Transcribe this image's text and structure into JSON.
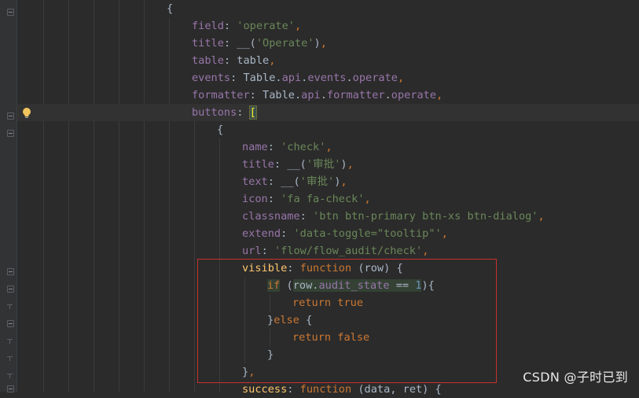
{
  "editor": {
    "lines": [
      {
        "parts": [
          {
            "t": "{",
            "c": "plain"
          }
        ]
      },
      {
        "parts": [
          {
            "t": "field",
            "c": "p"
          },
          {
            "t": ": ",
            "c": "plain"
          },
          {
            "t": "'operate'",
            "c": "s"
          },
          {
            "t": ",",
            "c": "k"
          }
        ]
      },
      {
        "parts": [
          {
            "t": "title",
            "c": "p"
          },
          {
            "t": ": __(",
            "c": "plain"
          },
          {
            "t": "'Operate'",
            "c": "s"
          },
          {
            "t": ")",
            "c": "plain"
          },
          {
            "t": ",",
            "c": "k"
          }
        ]
      },
      {
        "parts": [
          {
            "t": "table",
            "c": "p"
          },
          {
            "t": ": table",
            "c": "plain"
          },
          {
            "t": ",",
            "c": "k"
          }
        ]
      },
      {
        "parts": [
          {
            "t": "events",
            "c": "p"
          },
          {
            "t": ": Table.",
            "c": "plain"
          },
          {
            "t": "api",
            "c": "p"
          },
          {
            "t": ".",
            "c": "plain"
          },
          {
            "t": "events",
            "c": "p"
          },
          {
            "t": ".",
            "c": "plain"
          },
          {
            "t": "operate",
            "c": "p"
          },
          {
            "t": ",",
            "c": "k"
          }
        ]
      },
      {
        "parts": [
          {
            "t": "formatter",
            "c": "p"
          },
          {
            "t": ": Table.",
            "c": "plain"
          },
          {
            "t": "api",
            "c": "p"
          },
          {
            "t": ".",
            "c": "plain"
          },
          {
            "t": "formatter",
            "c": "p"
          },
          {
            "t": ".",
            "c": "plain"
          },
          {
            "t": "operate",
            "c": "p"
          },
          {
            "t": ",",
            "c": "k"
          }
        ]
      },
      {
        "parts": [
          {
            "t": "buttons",
            "c": "p"
          },
          {
            "t": ": ",
            "c": "plain"
          },
          {
            "t": "[",
            "c": "bracket-hl"
          }
        ]
      },
      {
        "parts": [
          {
            "t": "{",
            "c": "plain"
          }
        ]
      },
      {
        "parts": [
          {
            "t": "name",
            "c": "p"
          },
          {
            "t": ": ",
            "c": "plain"
          },
          {
            "t": "'check'",
            "c": "s"
          },
          {
            "t": ",",
            "c": "k"
          }
        ]
      },
      {
        "parts": [
          {
            "t": "title",
            "c": "p"
          },
          {
            "t": ": __(",
            "c": "plain"
          },
          {
            "t": "'审批'",
            "c": "s"
          },
          {
            "t": ")",
            "c": "plain"
          },
          {
            "t": ",",
            "c": "k"
          }
        ]
      },
      {
        "parts": [
          {
            "t": "text",
            "c": "p"
          },
          {
            "t": ": __(",
            "c": "plain"
          },
          {
            "t": "'审批'",
            "c": "s"
          },
          {
            "t": ")",
            "c": "plain"
          },
          {
            "t": ",",
            "c": "k"
          }
        ]
      },
      {
        "parts": [
          {
            "t": "icon",
            "c": "p"
          },
          {
            "t": ": ",
            "c": "plain"
          },
          {
            "t": "'fa fa-check'",
            "c": "s"
          },
          {
            "t": ",",
            "c": "k"
          }
        ]
      },
      {
        "parts": [
          {
            "t": "classname",
            "c": "p"
          },
          {
            "t": ": ",
            "c": "plain"
          },
          {
            "t": "'btn btn-primary btn-xs btn-dialog'",
            "c": "s"
          },
          {
            "t": ",",
            "c": "k"
          }
        ]
      },
      {
        "parts": [
          {
            "t": "extend",
            "c": "p"
          },
          {
            "t": ": ",
            "c": "plain"
          },
          {
            "t": "'data-toggle=\"tooltip\"'",
            "c": "s"
          },
          {
            "t": ",",
            "c": "k"
          }
        ]
      },
      {
        "parts": [
          {
            "t": "url",
            "c": "p"
          },
          {
            "t": ": ",
            "c": "plain"
          },
          {
            "t": "'flow/flow_audit/check'",
            "c": "s"
          },
          {
            "t": ",",
            "c": "k"
          }
        ]
      },
      {
        "parts": [
          {
            "t": "visible",
            "c": "fn"
          },
          {
            "t": ": ",
            "c": "plain"
          },
          {
            "t": "function ",
            "c": "k"
          },
          {
            "t": "(row) {",
            "c": "plain"
          }
        ]
      },
      {
        "parts": [
          {
            "t": "if",
            "c": "k hl-k"
          },
          {
            "t": " (",
            "c": "plain"
          },
          {
            "t": "row.",
            "c": "hl"
          },
          {
            "t": "audit_state",
            "c": "p hl-k"
          },
          {
            "t": " == ",
            "c": "hl"
          },
          {
            "t": "1",
            "c": "n hl-k"
          },
          {
            "t": "){",
            "c": "plain"
          }
        ]
      },
      {
        "parts": [
          {
            "t": "return true",
            "c": "k"
          }
        ]
      },
      {
        "parts": [
          {
            "t": "}",
            "c": "plain"
          },
          {
            "t": "else",
            "c": "k"
          },
          {
            "t": " {",
            "c": "plain"
          }
        ]
      },
      {
        "parts": [
          {
            "t": "return false",
            "c": "k"
          }
        ]
      },
      {
        "parts": [
          {
            "t": "}",
            "c": "plain"
          }
        ]
      },
      {
        "parts": [
          {
            "t": "}",
            "c": "plain"
          },
          {
            "t": ",",
            "c": "k"
          }
        ]
      },
      {
        "parts": [
          {
            "t": "success",
            "c": "fn"
          },
          {
            "t": ": ",
            "c": "plain"
          },
          {
            "t": "function ",
            "c": "k"
          },
          {
            "t": "(data, ret) {",
            "c": "plain"
          }
        ]
      }
    ]
  },
  "watermark": "CSDN @子时已到"
}
